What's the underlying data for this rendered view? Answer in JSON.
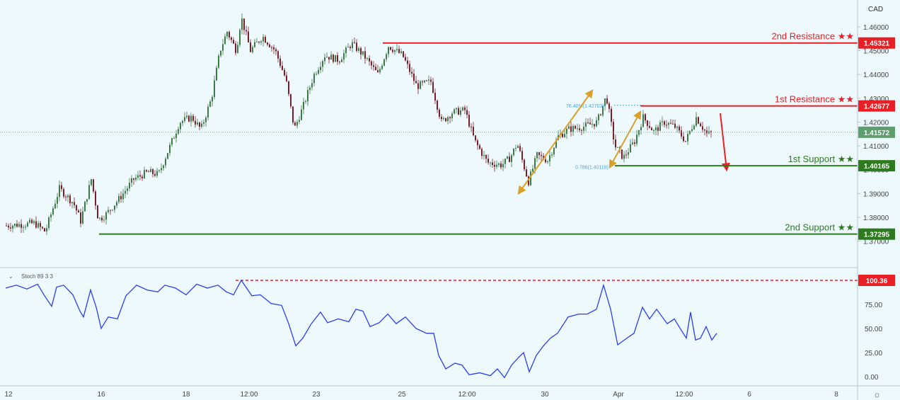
{
  "colors": {
    "background": "#eef9fd",
    "candle_up": "#3c7a46",
    "candle_down": "#7a1f2a",
    "stoch": "#2a3df0",
    "resistance": "#e81f24",
    "support": "#2d7a1f",
    "arrow_gold": "#d9a02a",
    "fib": "#4aa8e0",
    "current_price": "#5d9e6e"
  },
  "chart_data": [
    {
      "type": "candlestick",
      "currency": "CAD",
      "y_ticks": [
        "1.37000",
        "1.38000",
        "1.39000",
        "1.40000",
        "1.41000",
        "1.42000",
        "1.43000",
        "1.44000",
        "1.45000",
        "1.46000"
      ],
      "x_ticks": [
        "12",
        "16",
        "18",
        "12:00",
        "23",
        "25",
        "12:00",
        "30",
        "Apr",
        "12:00",
        "6",
        "8"
      ],
      "ylim": [
        1.3675,
        1.4665
      ],
      "close_path": [
        [
          0,
          1.3765
        ],
        [
          40,
          1.3775
        ],
        [
          55,
          1.374
        ],
        [
          75,
          1.392
        ],
        [
          95,
          1.386
        ],
        [
          105,
          1.3785
        ],
        [
          120,
          1.396
        ],
        [
          130,
          1.379
        ],
        [
          140,
          1.381
        ],
        [
          160,
          1.388
        ],
        [
          180,
          1.396
        ],
        [
          200,
          1.399
        ],
        [
          215,
          1.398
        ],
        [
          230,
          1.409
        ],
        [
          245,
          1.42
        ],
        [
          262,
          1.422
        ],
        [
          275,
          1.417
        ],
        [
          290,
          1.43
        ],
        [
          302,
          1.45
        ],
        [
          312,
          1.458
        ],
        [
          325,
          1.45
        ],
        [
          332,
          1.464
        ],
        [
          345,
          1.45
        ],
        [
          362,
          1.456
        ],
        [
          380,
          1.45
        ],
        [
          395,
          1.438
        ],
        [
          407,
          1.417
        ],
        [
          420,
          1.427
        ],
        [
          435,
          1.44
        ],
        [
          450,
          1.448
        ],
        [
          470,
          1.446
        ],
        [
          488,
          1.453
        ],
        [
          505,
          1.448
        ],
        [
          525,
          1.44
        ],
        [
          540,
          1.452
        ],
        [
          560,
          1.448
        ],
        [
          580,
          1.435
        ],
        [
          600,
          1.437
        ],
        [
          615,
          1.42
        ],
        [
          630,
          1.424
        ],
        [
          648,
          1.425
        ],
        [
          662,
          1.412
        ],
        [
          680,
          1.403
        ],
        [
          700,
          1.402
        ],
        [
          712,
          1.405
        ],
        [
          722,
          1.411
        ],
        [
          738,
          1.395
        ],
        [
          750,
          1.406
        ],
        [
          765,
          1.404
        ],
        [
          780,
          1.414
        ],
        [
          795,
          1.417
        ],
        [
          815,
          1.418
        ],
        [
          835,
          1.42
        ],
        [
          848,
          1.431
        ],
        [
          860,
          1.41
        ],
        [
          872,
          1.405
        ],
        [
          888,
          1.412
        ],
        [
          900,
          1.422
        ],
        [
          915,
          1.416
        ],
        [
          930,
          1.42
        ],
        [
          945,
          1.418
        ],
        [
          960,
          1.412
        ],
        [
          975,
          1.422
        ],
        [
          990,
          1.415
        ],
        [
          1005,
          1.4155
        ]
      ],
      "levels": [
        {
          "name": "2nd Resistance ★★",
          "value": "1.45321",
          "price": 1.45321
        },
        {
          "name": "1st Resistance ★★",
          "value": "1.42677",
          "price": 1.42677
        },
        {
          "name": "1st Support ★★",
          "value": "1.40165",
          "price": 1.40165
        },
        {
          "name": "2nd Support ★★",
          "value": "1.37295",
          "price": 1.37295
        }
      ],
      "current_price": {
        "value": "1.41572",
        "price": 1.41572
      },
      "fib_labels": [
        {
          "text": "76.40%(1.42703)",
          "price": 1.42703
        },
        {
          "text": "0.786(1.40118)",
          "price": 1.40118
        }
      ]
    },
    {
      "type": "line",
      "indicator": "Stoch 89 3 3",
      "y_ticks": [
        "100.36",
        "75.00",
        "50.00",
        "25.00",
        "0.00"
      ],
      "ylim": [
        0,
        100
      ],
      "series": [
        {
          "values": [
            [
              0,
              92
            ],
            [
              15,
              95
            ],
            [
              30,
              91
            ],
            [
              45,
              96
            ],
            [
              55,
              84
            ],
            [
              65,
              73
            ],
            [
              72,
              93
            ],
            [
              82,
              95
            ],
            [
              95,
              85
            ],
            [
              105,
              68
            ],
            [
              110,
              62
            ],
            [
              120,
              90
            ],
            [
              128,
              72
            ],
            [
              135,
              50
            ],
            [
              145,
              62
            ],
            [
              158,
              60
            ],
            [
              170,
              84
            ],
            [
              185,
              95
            ],
            [
              200,
              90
            ],
            [
              215,
              88
            ],
            [
              225,
              95
            ],
            [
              240,
              92
            ],
            [
              255,
              85
            ],
            [
              270,
              96
            ],
            [
              285,
              92
            ],
            [
              300,
              95
            ],
            [
              312,
              88
            ],
            [
              322,
              85
            ],
            [
              333,
              100
            ],
            [
              348,
              84
            ],
            [
              360,
              85
            ],
            [
              375,
              76
            ],
            [
              390,
              74
            ],
            [
              400,
              55
            ],
            [
              410,
              32
            ],
            [
              420,
              40
            ],
            [
              432,
              55
            ],
            [
              445,
              67
            ],
            [
              455,
              56
            ],
            [
              470,
              60
            ],
            [
              485,
              57
            ],
            [
              495,
              70
            ],
            [
              505,
              68
            ],
            [
              515,
              52
            ],
            [
              528,
              56
            ],
            [
              540,
              65
            ],
            [
              552,
              55
            ],
            [
              565,
              62
            ],
            [
              580,
              50
            ],
            [
              595,
              45
            ],
            [
              605,
              45
            ],
            [
              612,
              22
            ],
            [
              622,
              8
            ],
            [
              635,
              14
            ],
            [
              645,
              12
            ],
            [
              655,
              2
            ],
            [
              670,
              4
            ],
            [
              685,
              1
            ],
            [
              695,
              8
            ],
            [
              705,
              -1
            ],
            [
              715,
              12
            ],
            [
              725,
              20
            ],
            [
              732,
              25
            ],
            [
              740,
              5
            ],
            [
              750,
              22
            ],
            [
              760,
              32
            ],
            [
              770,
              40
            ],
            [
              780,
              45
            ],
            [
              795,
              62
            ],
            [
              810,
              65
            ],
            [
              822,
              65
            ],
            [
              835,
              70
            ],
            [
              845,
              95
            ],
            [
              855,
              70
            ],
            [
              865,
              33
            ],
            [
              878,
              40
            ],
            [
              888,
              45
            ],
            [
              900,
              72
            ],
            [
              910,
              60
            ],
            [
              920,
              70
            ],
            [
              935,
              55
            ],
            [
              945,
              60
            ],
            [
              955,
              48
            ],
            [
              962,
              40
            ],
            [
              968,
              67
            ],
            [
              975,
              38
            ],
            [
              982,
              40
            ],
            [
              990,
              52
            ],
            [
              998,
              38
            ],
            [
              1005,
              45
            ]
          ]
        }
      ]
    }
  ]
}
